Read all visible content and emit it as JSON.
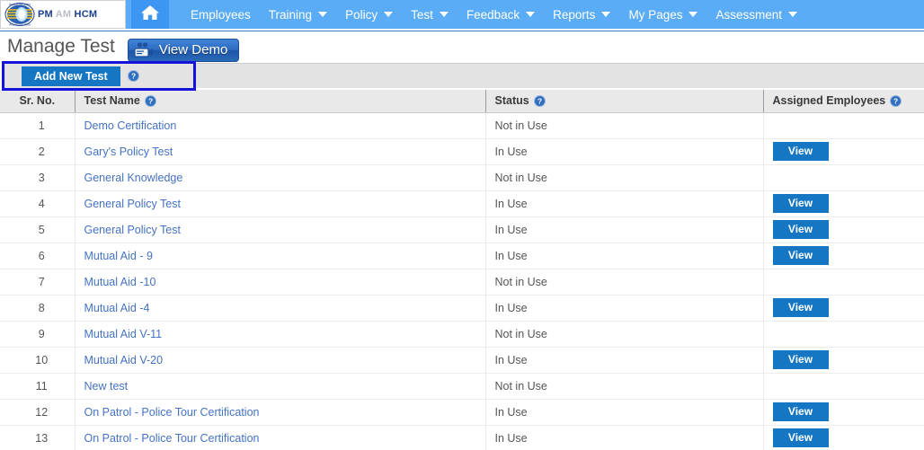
{
  "navbar": {
    "logo": {
      "icon": "globe-logo-icon",
      "text_pm": "PM",
      "text_am": "AM",
      "text_hcm": "HCM"
    },
    "home_icon": "home-icon",
    "items": [
      {
        "label": "Employees",
        "has_dropdown": false
      },
      {
        "label": "Training",
        "has_dropdown": true
      },
      {
        "label": "Policy",
        "has_dropdown": true
      },
      {
        "label": "Test",
        "has_dropdown": true
      },
      {
        "label": "Feedback",
        "has_dropdown": true
      },
      {
        "label": "Reports",
        "has_dropdown": true
      },
      {
        "label": "My Pages",
        "has_dropdown": true
      },
      {
        "label": "Assessment",
        "has_dropdown": true
      }
    ]
  },
  "header": {
    "title": "Manage Test",
    "view_demo_label": "View Demo",
    "view_demo_icon": "video-camera-icon"
  },
  "toolbar": {
    "add_new_test_label": "Add New Test",
    "help_icon": "help-question-icon"
  },
  "annotation": {
    "color": "#1414d8"
  },
  "table": {
    "columns": [
      {
        "key": "sr",
        "label": "Sr. No.",
        "help": false
      },
      {
        "key": "name",
        "label": "Test Name",
        "help": true
      },
      {
        "key": "status",
        "label": "Status",
        "help": true
      },
      {
        "key": "assigned",
        "label": "Assigned Employees",
        "help": true
      }
    ],
    "view_button_label": "View",
    "rows": [
      {
        "sr": "1",
        "name": "Demo Certification",
        "status": "Not in Use",
        "has_view": false
      },
      {
        "sr": "2",
        "name": "Gary's Policy Test",
        "status": "In Use",
        "has_view": true
      },
      {
        "sr": "3",
        "name": "General Knowledge",
        "status": "Not in Use",
        "has_view": false
      },
      {
        "sr": "4",
        "name": "General Policy Test",
        "status": "In Use",
        "has_view": true
      },
      {
        "sr": "5",
        "name": "General Policy Test",
        "status": "In Use",
        "has_view": true
      },
      {
        "sr": "6",
        "name": "Mutual Aid - 9",
        "status": "In Use",
        "has_view": true
      },
      {
        "sr": "7",
        "name": "Mutual Aid -10",
        "status": "Not in Use",
        "has_view": false
      },
      {
        "sr": "8",
        "name": "Mutual Aid -4",
        "status": "In Use",
        "has_view": true
      },
      {
        "sr": "9",
        "name": "Mutual Aid V-11",
        "status": "Not in Use",
        "has_view": false
      },
      {
        "sr": "10",
        "name": "Mutual Aid V-20",
        "status": "In Use",
        "has_view": true
      },
      {
        "sr": "11",
        "name": "New test",
        "status": "Not in Use",
        "has_view": false
      },
      {
        "sr": "12",
        "name": "On Patrol - Police Tour Certification",
        "status": "In Use",
        "has_view": true
      },
      {
        "sr": "13",
        "name": "On Patrol - Police Tour Certification",
        "status": "In Use",
        "has_view": true
      }
    ]
  },
  "colors": {
    "nav_blue": "#5aacf7",
    "button_blue": "#1577c4",
    "link_blue": "#4472c4",
    "annotation_blue": "#1414d8"
  }
}
